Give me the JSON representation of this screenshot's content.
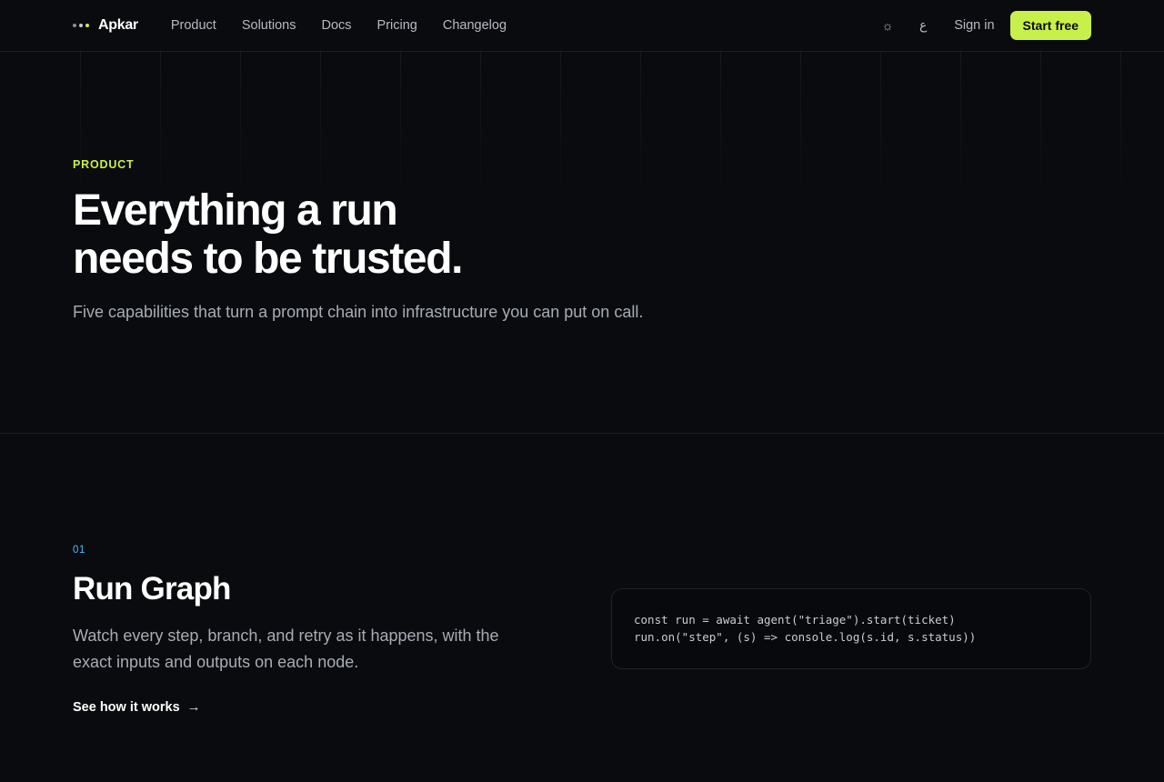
{
  "brand": {
    "name": "Apkar",
    "logo_icon": "three-dots-logo-icon"
  },
  "nav": {
    "items": [
      {
        "label": "Product"
      },
      {
        "label": "Solutions"
      },
      {
        "label": "Docs"
      },
      {
        "label": "Pricing"
      },
      {
        "label": "Changelog"
      }
    ]
  },
  "header_actions": {
    "theme_icon": "sun-icon",
    "theme_glyph": "☼",
    "language_icon": "language-icon",
    "language_glyph": "ع",
    "signin_label": "Sign in",
    "cta_label": "Start free"
  },
  "hero": {
    "eyebrow": "PRODUCT",
    "title_line1": "Everything a run",
    "title_line2": "needs to be trusted.",
    "subtitle": "Five capabilities that turn a prompt chain into infrastructure you can put on call."
  },
  "feature": {
    "number": "01",
    "title": "Run Graph",
    "description": "Watch every step, branch, and retry as it happens, with the exact inputs and outputs on each node.",
    "link_label": "See how it works",
    "link_arrow": "→",
    "code_lines": [
      "const run = await agent(\"triage\").start(ticket)",
      "run.on(\"step\", (s) => console.log(s.id, s.status))"
    ]
  },
  "colors": {
    "background": "#0a0b0e",
    "accent": "#c8f04a",
    "feature_number": "#4fb8ff"
  }
}
